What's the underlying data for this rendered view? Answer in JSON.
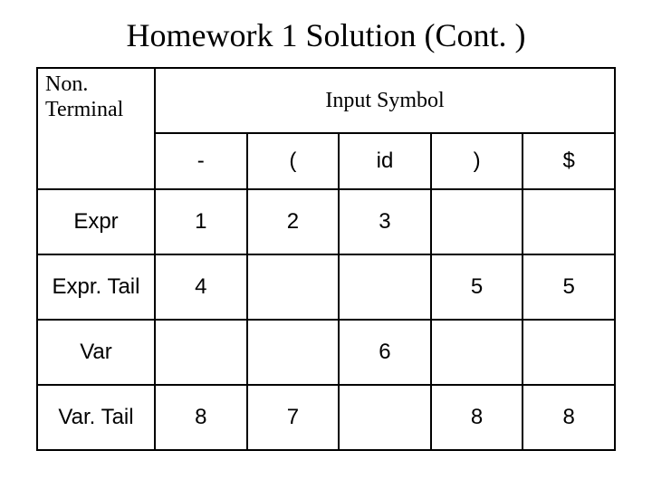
{
  "title": "Homework 1 Solution (Cont. )",
  "headers": {
    "nonterminal_line1": "Non.",
    "nonterminal_line2": "Terminal",
    "input_symbol": "Input Symbol"
  },
  "symbols": [
    "-",
    "(",
    "id",
    ")",
    "$"
  ],
  "rows": [
    {
      "label": "Expr",
      "cells": [
        "1",
        "2",
        "3",
        "",
        ""
      ]
    },
    {
      "label": "Expr. Tail",
      "cells": [
        "4",
        "",
        "",
        "5",
        "5"
      ]
    },
    {
      "label": "Var",
      "cells": [
        "",
        "",
        "6",
        "",
        ""
      ]
    },
    {
      "label": "Var. Tail",
      "cells": [
        "8",
        "7",
        "",
        "8",
        "8"
      ]
    }
  ],
  "chart_data": {
    "type": "table",
    "title": "Homework 1 Solution (Cont. )",
    "row_header": "Non. Terminal",
    "col_header": "Input Symbol",
    "columns": [
      "-",
      "(",
      "id",
      ")",
      "$"
    ],
    "rows": [
      "Expr",
      "Expr. Tail",
      "Var",
      "Var. Tail"
    ],
    "cells": [
      [
        "1",
        "2",
        "3",
        "",
        ""
      ],
      [
        "4",
        "",
        "",
        "5",
        "5"
      ],
      [
        "",
        "",
        "6",
        "",
        ""
      ],
      [
        "8",
        "7",
        "",
        "8",
        "8"
      ]
    ]
  }
}
